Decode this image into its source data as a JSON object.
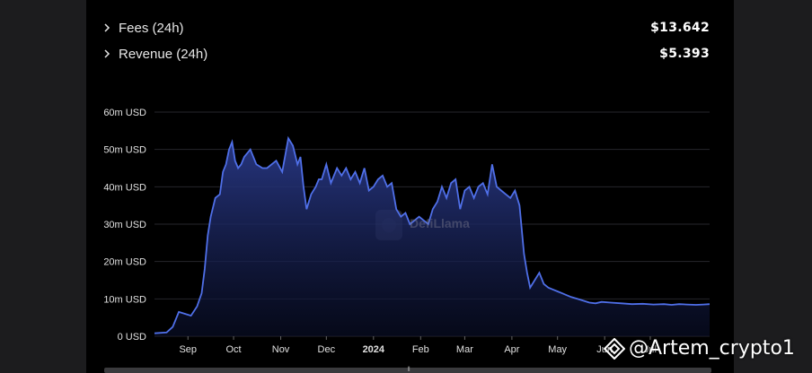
{
  "metrics": [
    {
      "label": "Fees (24h)",
      "value": "$13.642"
    },
    {
      "label": "Revenue (24h)",
      "value": "$5.393"
    }
  ],
  "watermark": "DefiLlama",
  "credit": "@Artem_crypto1",
  "colors": {
    "line": "#4f6fe8",
    "fill_top": "#2a3a8a",
    "background": "#000000"
  },
  "chart_data": {
    "type": "area",
    "title": "",
    "xlabel": "",
    "ylabel": "",
    "ylim": [
      0,
      60
    ],
    "y_ticks": [
      "0 USD",
      "10m USD",
      "20m USD",
      "30m USD",
      "40m USD",
      "50m USD",
      "60m USD"
    ],
    "x_ticks": [
      "Sep",
      "Oct",
      "Nov",
      "Dec",
      "2024",
      "Feb",
      "Mar",
      "Apr",
      "May",
      "Jun",
      "Jul"
    ],
    "grid": "horizontal",
    "series": [
      {
        "unit": "m USD",
        "x": [
          "2023-08-10",
          "2023-08-18",
          "2023-08-22",
          "2023-08-26",
          "2023-08-30",
          "2023-09-03",
          "2023-09-07",
          "2023-09-10",
          "2023-09-12",
          "2023-09-14",
          "2023-09-16",
          "2023-09-19",
          "2023-09-22",
          "2023-09-24",
          "2023-09-26",
          "2023-09-28",
          "2023-09-30",
          "2023-10-02",
          "2023-10-04",
          "2023-10-06",
          "2023-10-08",
          "2023-10-12",
          "2023-10-16",
          "2023-10-20",
          "2023-10-23",
          "2023-10-26",
          "2023-10-29",
          "2023-11-02",
          "2023-11-06",
          "2023-11-09",
          "2023-11-12",
          "2023-11-14",
          "2023-11-16",
          "2023-11-18",
          "2023-11-21",
          "2023-11-24",
          "2023-11-26",
          "2023-11-28",
          "2023-12-01",
          "2023-12-04",
          "2023-12-06",
          "2023-12-08",
          "2023-12-11",
          "2023-12-14",
          "2023-12-17",
          "2023-12-20",
          "2023-12-23",
          "2023-12-26",
          "2023-12-29",
          "2024-01-01",
          "2024-01-04",
          "2024-01-07",
          "2024-01-10",
          "2024-01-13",
          "2024-01-16",
          "2024-01-19",
          "2024-01-22",
          "2024-01-25",
          "2024-01-28",
          "2024-01-31",
          "2024-02-03",
          "2024-02-06",
          "2024-02-09",
          "2024-02-12",
          "2024-02-15",
          "2024-02-18",
          "2024-02-21",
          "2024-02-24",
          "2024-02-27",
          "2024-03-01",
          "2024-03-04",
          "2024-03-07",
          "2024-03-10",
          "2024-03-13",
          "2024-03-16",
          "2024-03-19",
          "2024-03-22",
          "2024-03-25",
          "2024-03-28",
          "2024-03-31",
          "2024-04-03",
          "2024-04-06",
          "2024-04-09",
          "2024-04-11",
          "2024-04-13",
          "2024-04-16",
          "2024-04-19",
          "2024-04-22",
          "2024-04-25",
          "2024-04-28",
          "2024-05-01",
          "2024-05-04",
          "2024-05-07",
          "2024-05-10",
          "2024-05-14",
          "2024-05-18",
          "2024-05-22",
          "2024-05-26",
          "2024-05-30",
          "2024-06-05",
          "2024-06-12",
          "2024-06-19",
          "2024-06-26",
          "2024-07-03",
          "2024-07-10",
          "2024-07-15",
          "2024-07-20",
          "2024-07-25",
          "2024-07-31",
          "2024-08-05",
          "2024-08-09"
        ],
        "values": [
          0.8,
          1.0,
          2.5,
          6.5,
          6.0,
          5.5,
          8.0,
          11.5,
          18.0,
          27.0,
          32.0,
          37.0,
          38.0,
          44.0,
          46.0,
          50.0,
          52.0,
          47.0,
          45.0,
          46.0,
          48.0,
          50.0,
          46.0,
          45.0,
          45.0,
          46.0,
          47.0,
          44.0,
          53.0,
          51.0,
          46.0,
          48.0,
          40.0,
          34.0,
          38.0,
          40.0,
          42.0,
          42.0,
          46.0,
          41.0,
          43.0,
          45.0,
          43.0,
          45.0,
          42.0,
          44.0,
          41.0,
          45.0,
          39.0,
          40.0,
          42.0,
          43.0,
          40.0,
          41.0,
          34.0,
          32.0,
          33.0,
          30.0,
          31.0,
          32.0,
          31.0,
          30.0,
          34.0,
          36.0,
          40.0,
          37.0,
          41.0,
          42.0,
          34.0,
          39.0,
          40.0,
          37.0,
          40.0,
          41.0,
          38.0,
          46.0,
          40.0,
          39.0,
          38.0,
          37.0,
          39.0,
          35.0,
          22.0,
          17.0,
          13.0,
          15.0,
          17.0,
          14.0,
          13.0,
          12.5,
          12.0,
          11.5,
          11.0,
          10.5,
          10.0,
          9.5,
          9.0,
          8.8,
          9.2,
          9.0,
          8.8,
          8.6,
          8.7,
          8.5,
          8.6,
          8.4,
          8.6,
          8.5,
          8.4,
          8.5,
          8.6
        ]
      }
    ]
  }
}
